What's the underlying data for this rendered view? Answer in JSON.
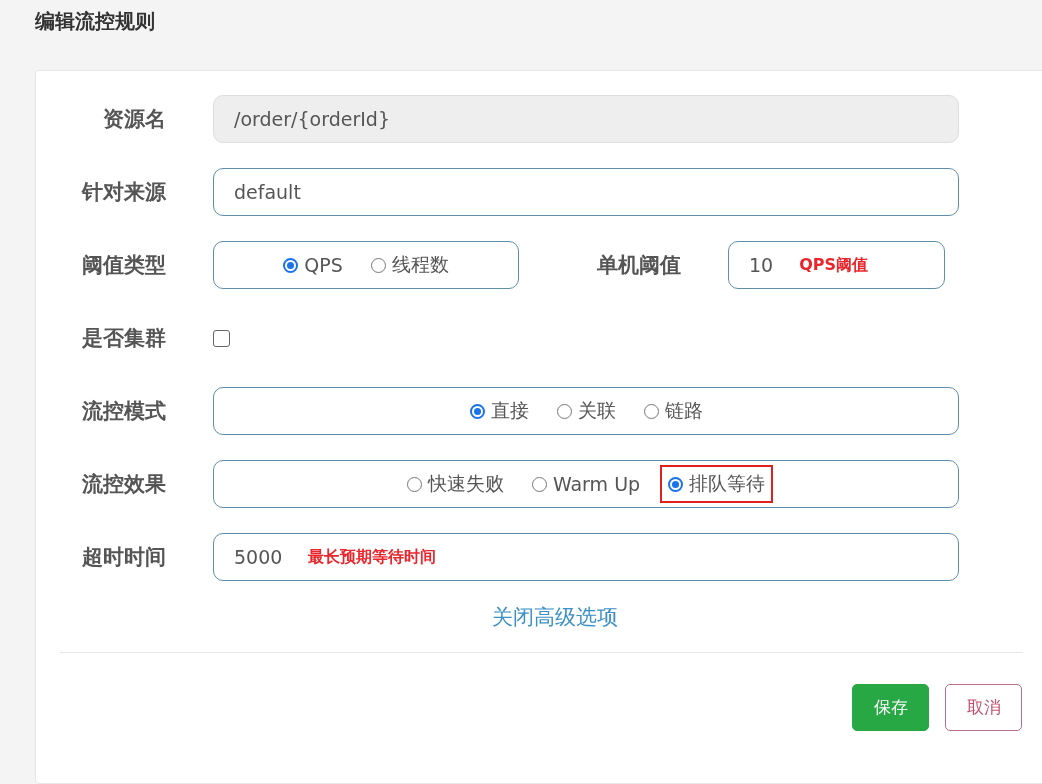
{
  "dialog": {
    "title": "编辑流控规则"
  },
  "rows": [
    {
      "kind": "input",
      "label": "资源名",
      "value": "/order/{orderId}",
      "disabled": true
    },
    {
      "kind": "input",
      "label": "针对来源",
      "value": "default",
      "disabled": false
    },
    {
      "kind": "threshold",
      "label": "阈值类型",
      "options": [
        {
          "label": "QPS",
          "selected": true
        },
        {
          "label": "线程数",
          "selected": false
        }
      ],
      "threshold": {
        "label": "单机阈值",
        "value": "10",
        "note": "QPS阈值"
      }
    },
    {
      "kind": "checkbox",
      "label": "是否集群",
      "checked": false
    },
    {
      "kind": "radio",
      "label": "流控模式",
      "options": [
        {
          "label": "直接",
          "selected": true
        },
        {
          "label": "关联",
          "selected": false
        },
        {
          "label": "链路",
          "selected": false
        }
      ]
    },
    {
      "kind": "radio",
      "label": "流控效果",
      "options": [
        {
          "label": "快速失败",
          "selected": false,
          "highlighted": false
        },
        {
          "label": "Warm Up",
          "selected": false,
          "highlighted": false
        },
        {
          "label": "排队等待",
          "selected": true,
          "highlighted": true
        }
      ]
    },
    {
      "kind": "input",
      "label": "超时时间",
      "value": "5000",
      "disabled": false,
      "note": "最长预期等待时间"
    }
  ],
  "link": "关闭高级选项",
  "buttons": [
    {
      "label": "保存",
      "kind": "primary"
    },
    {
      "label": "取消",
      "kind": "cancel"
    }
  ]
}
